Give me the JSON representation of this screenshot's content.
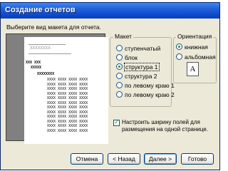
{
  "window": {
    "title": "Создание отчетов"
  },
  "prompt": "Выберите вид макета для отчета.",
  "preview": {
    "title": "XXXXXXXX",
    "header1": "XXX XXX",
    "header2": "XXXXX",
    "header3": "XXXXXXXX",
    "rows": [
      "XXXX XXXX XXXX XXXX",
      "XXXX XXXX XXXX XXXX",
      "XXXX XXXX XXXX XXXX",
      "XXXX XXXX XXXX XXXX",
      "XXXX XXXX XXXX XXXX",
      "XXXX XXXX XXXX XXXX",
      "XXXX XXXX XXXX XXXX",
      "XXXX XXXX XXXX XXXX",
      "XXXX XXXX XXXX XXXX",
      "XXXX XXXX XXXX XXXX",
      "XXXX XXXX XXXX XXXX",
      "XXXX XXXX XXXX XXXX"
    ]
  },
  "layout": {
    "label": "Макет",
    "options": [
      {
        "label": "ступенчатый",
        "checked": false
      },
      {
        "label": "блок",
        "checked": false
      },
      {
        "label": "структура 1",
        "checked": true
      },
      {
        "label": "структура 2",
        "checked": false
      },
      {
        "label": "по левому краю 1",
        "checked": false
      },
      {
        "label": "по левому краю 2",
        "checked": false
      }
    ]
  },
  "orientation": {
    "label": "Ориентация",
    "options": [
      {
        "label": "книжная",
        "checked": true
      },
      {
        "label": "альбомная",
        "checked": false
      }
    ],
    "icon_letter": "A"
  },
  "fit_width": {
    "label": "Настроить ширину полей для размещения на одной странице.",
    "checked": true
  },
  "buttons": {
    "cancel": "Отмена",
    "back": "< Назад",
    "next": "Далее >",
    "finish": "Готово"
  }
}
